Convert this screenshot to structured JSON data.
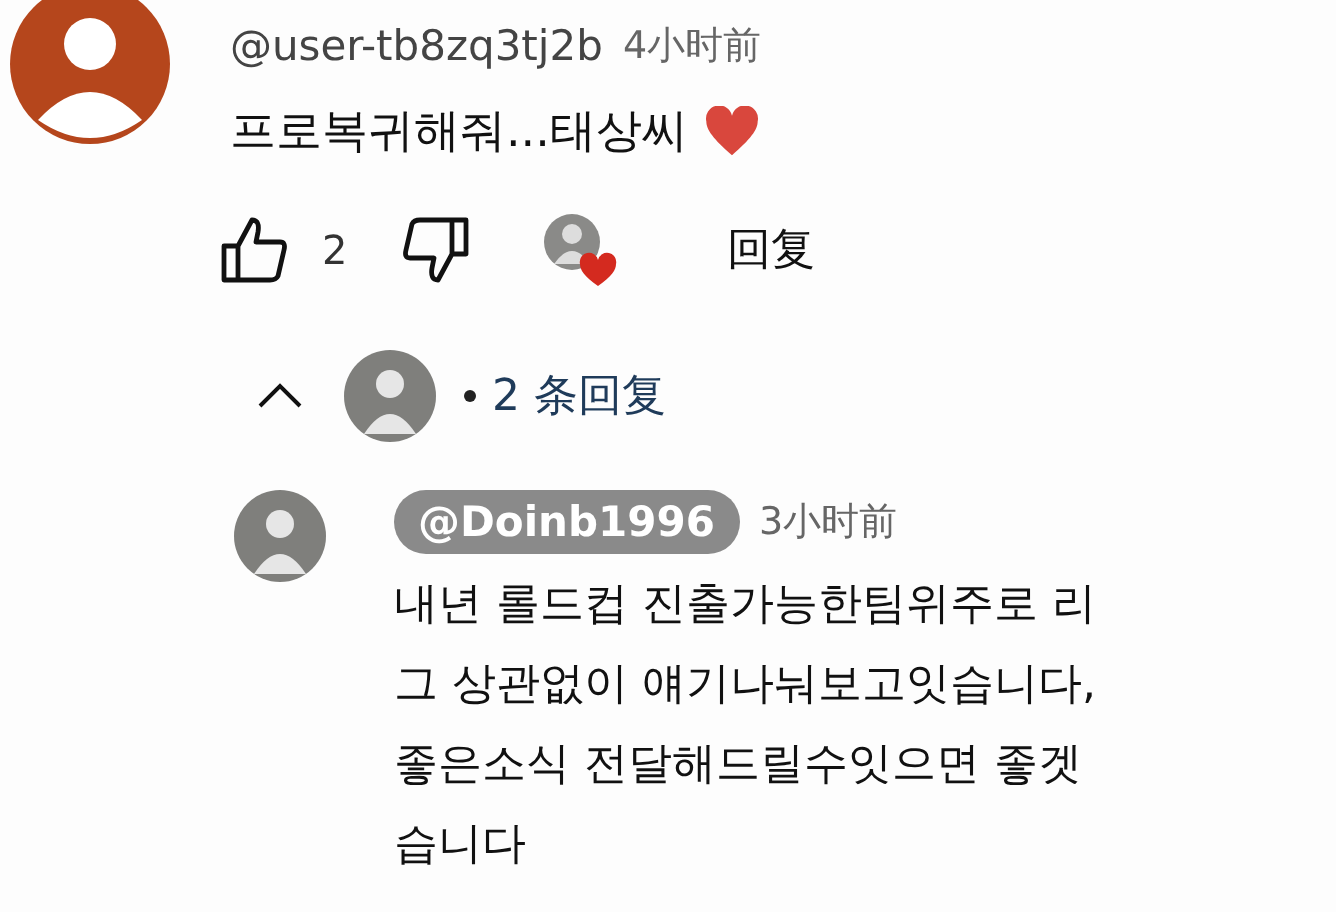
{
  "comment": {
    "author": "@user-tb8zq3tj2b",
    "time": "4小时前",
    "text": "프로복귀해줘...태상씨",
    "heart_emoji": true,
    "likes": "2",
    "creator_heart": true,
    "reply_button": "回复"
  },
  "replies_toggle": {
    "expanded": true,
    "count": "2 条回复"
  },
  "reply": {
    "author": "@Doinb1996",
    "author_is_creator": true,
    "time": "3小时前",
    "text": "내년 롤드컵 진출가능한팀위주로 리\n그 상관없이 얘기나눠보고잇습니다,\n좋은소식 전달해드릴수잇으면 좋겟\n습니다"
  }
}
